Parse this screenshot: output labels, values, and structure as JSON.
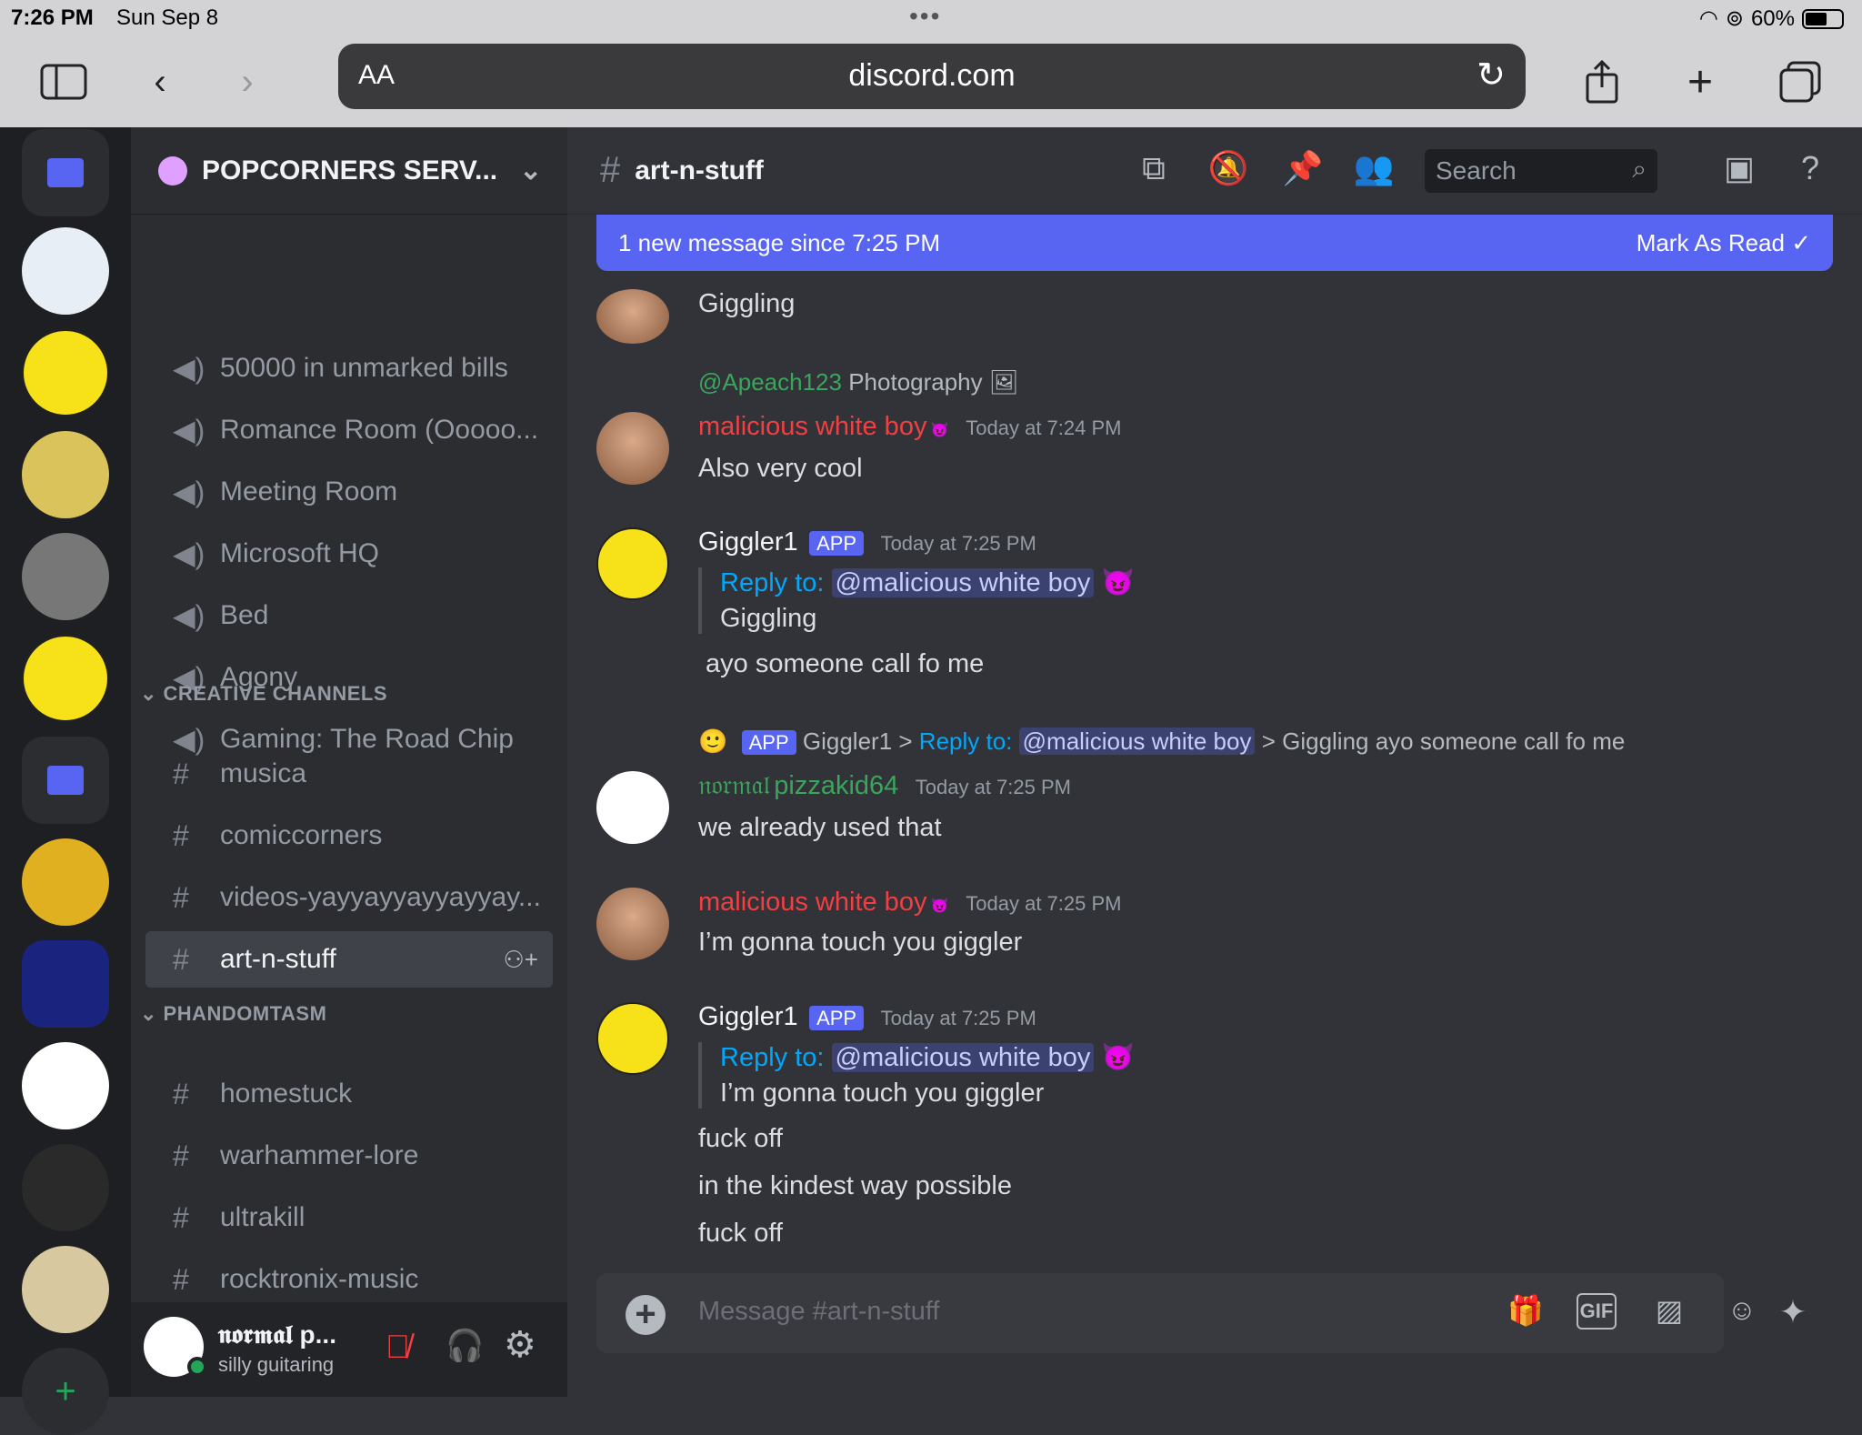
{
  "status": {
    "time": "7:26 PM",
    "date": "Sun Sep 8",
    "battery": "60%"
  },
  "browser": {
    "aa": "AA",
    "url": "discord.com"
  },
  "server": {
    "name": "POPCORNERS SERV..."
  },
  "voice_channels": [
    "50000 in unmarked bills",
    "Romance Room (Ooooo...",
    "Meeting Room",
    "Microsoft HQ",
    "Bed",
    "Agony",
    "Gaming: The Road Chip"
  ],
  "categories": {
    "creative": "CREATIVE CHANNELS",
    "phandom": "PHANDOMTASM"
  },
  "creative_channels": [
    "musica",
    "comiccorners",
    "videos-yayyayyayyayyay...",
    "art-n-stuff"
  ],
  "phandom_channels": [
    "homestuck",
    "warhammer-lore",
    "ultrakill",
    "rocktronix-music"
  ],
  "user": {
    "name": "𝖓𝖔𝖗𝖒𝖆𝖑 p...",
    "status": "silly guitaring"
  },
  "channel": {
    "name": "art-n-stuff",
    "search_placeholder": "Search"
  },
  "banner": {
    "text": "1 new message since 7:25 PM",
    "action": "Mark As Read"
  },
  "messages": {
    "m0_text": "Giggling",
    "m1_reply_user": "@Apeach123",
    "m1_reply_text": "Photography",
    "m1_name": "malicious white boy",
    "m1_time": "Today at 7:24 PM",
    "m1_text": "Also very cool",
    "m2_name": "Giggler1",
    "m2_badge": "APP",
    "m2_time": "Today at 7:25 PM",
    "m2_replyto": "Reply to:",
    "m2_mention": "@malicious white boy",
    "m2_quote": "Giggling",
    "m2_text": "ayo someone call fo me",
    "m3_ref_badge": "APP",
    "m3_ref_user": "Giggler1 >",
    "m3_ref_replyto": "Reply to:",
    "m3_ref_mention": "@malicious white boy",
    "m3_ref_text": "> Giggling  ayo someone call fo me",
    "m3_prefix": "𝔫𝔬𝔯𝔪𝔞𝔩",
    "m3_name": "pizzakid64",
    "m3_time": "Today at 7:25 PM",
    "m3_text": "we already used that",
    "m4_name": "malicious white boy",
    "m4_time": "Today at 7:25 PM",
    "m4_text": "I’m gonna touch you giggler",
    "m5_name": "Giggler1",
    "m5_badge": "APP",
    "m5_time": "Today at 7:25 PM",
    "m5_replyto": "Reply to:",
    "m5_mention": "@malicious white boy",
    "m5_quote": "I’m gonna touch you giggler",
    "m5_text1": "fuck off",
    "m5_text2": "in the kindest way possible",
    "m5_text3": "fuck off"
  },
  "composer": {
    "placeholder": "Message #art-n-stuff",
    "gif": "GIF"
  },
  "colors": {
    "blurple": "#5865f2",
    "red_name": "#f23f42",
    "green_name": "#3ba55c"
  }
}
